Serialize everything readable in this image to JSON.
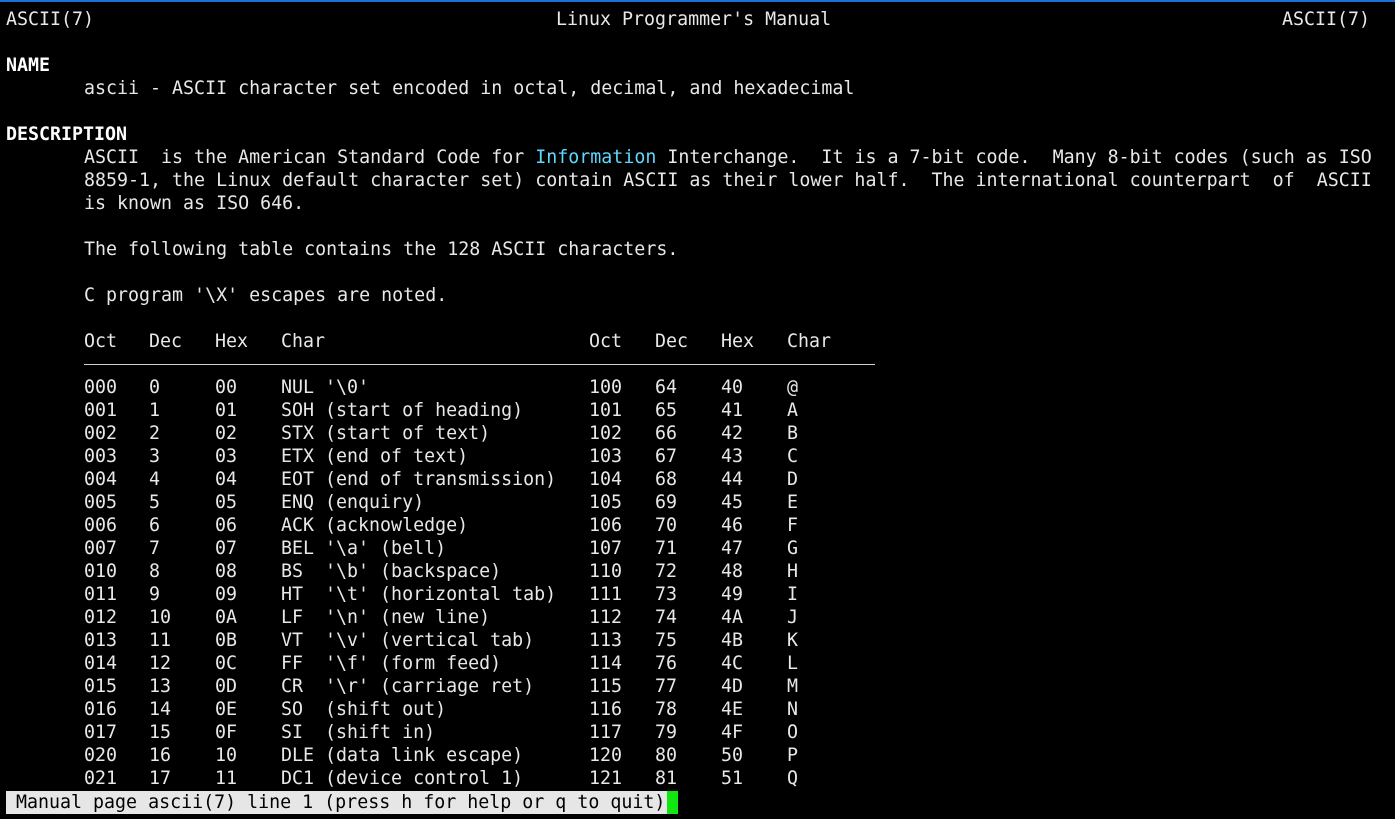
{
  "header": {
    "left": "ASCII(7)",
    "center": "Linux Programmer's Manual",
    "right": "ASCII(7)"
  },
  "name_section": {
    "heading": "NAME",
    "text": "ascii - ASCII character set encoded in octal, decimal, and hexadecimal"
  },
  "description_section": {
    "heading": "DESCRIPTION",
    "line1_before": "ASCII  is the American Standard Code for ",
    "line1_highlight": "Information",
    "line1_after": " Interchange.  It is a 7-bit code.  Many 8-bit codes (such as ISO",
    "line2": "8859-1, the Linux default character set) contain ASCII as their lower half.  The international counterpart  of  ASCII",
    "line3": "is known as ISO 646.",
    "para2": "The following table contains the 128 ASCII characters.",
    "para3": "C program '\\X' escapes are noted."
  },
  "table": {
    "headers": [
      "Oct",
      "Dec",
      "Hex",
      "Char",
      "Oct",
      "Dec",
      "Hex",
      "Char"
    ],
    "rows": [
      [
        "000",
        "0",
        "00",
        "NUL '\\0'",
        "100",
        "64",
        "40",
        "@"
      ],
      [
        "001",
        "1",
        "01",
        "SOH (start of heading)",
        "101",
        "65",
        "41",
        "A"
      ],
      [
        "002",
        "2",
        "02",
        "STX (start of text)",
        "102",
        "66",
        "42",
        "B"
      ],
      [
        "003",
        "3",
        "03",
        "ETX (end of text)",
        "103",
        "67",
        "43",
        "C"
      ],
      [
        "004",
        "4",
        "04",
        "EOT (end of transmission)",
        "104",
        "68",
        "44",
        "D"
      ],
      [
        "005",
        "5",
        "05",
        "ENQ (enquiry)",
        "105",
        "69",
        "45",
        "E"
      ],
      [
        "006",
        "6",
        "06",
        "ACK (acknowledge)",
        "106",
        "70",
        "46",
        "F"
      ],
      [
        "007",
        "7",
        "07",
        "BEL '\\a' (bell)",
        "107",
        "71",
        "47",
        "G"
      ],
      [
        "010",
        "8",
        "08",
        "BS  '\\b' (backspace)",
        "110",
        "72",
        "48",
        "H"
      ],
      [
        "011",
        "9",
        "09",
        "HT  '\\t' (horizontal tab)",
        "111",
        "73",
        "49",
        "I"
      ],
      [
        "012",
        "10",
        "0A",
        "LF  '\\n' (new line)",
        "112",
        "74",
        "4A",
        "J"
      ],
      [
        "013",
        "11",
        "0B",
        "VT  '\\v' (vertical tab)",
        "113",
        "75",
        "4B",
        "K"
      ],
      [
        "014",
        "12",
        "0C",
        "FF  '\\f' (form feed)",
        "114",
        "76",
        "4C",
        "L"
      ],
      [
        "015",
        "13",
        "0D",
        "CR  '\\r' (carriage ret)",
        "115",
        "77",
        "4D",
        "M"
      ],
      [
        "016",
        "14",
        "0E",
        "SO  (shift out)",
        "116",
        "78",
        "4E",
        "N"
      ],
      [
        "017",
        "15",
        "0F",
        "SI  (shift in)",
        "117",
        "79",
        "4F",
        "O"
      ],
      [
        "020",
        "16",
        "10",
        "DLE (data link escape)",
        "120",
        "80",
        "50",
        "P"
      ],
      [
        "021",
        "17",
        "11",
        "DC1 (device control 1)",
        "121",
        "81",
        "51",
        "Q"
      ]
    ]
  },
  "status_bar": {
    "text": "Manual page ascii(7) line 1 (press h for help or q to quit)"
  },
  "colors": {
    "background": "#000000",
    "text": "#e8e8e8",
    "highlight": "#5fd7ff",
    "cursor": "#11e611",
    "status_bg": "#e6e6e6",
    "window_border": "#1e6fd8"
  }
}
